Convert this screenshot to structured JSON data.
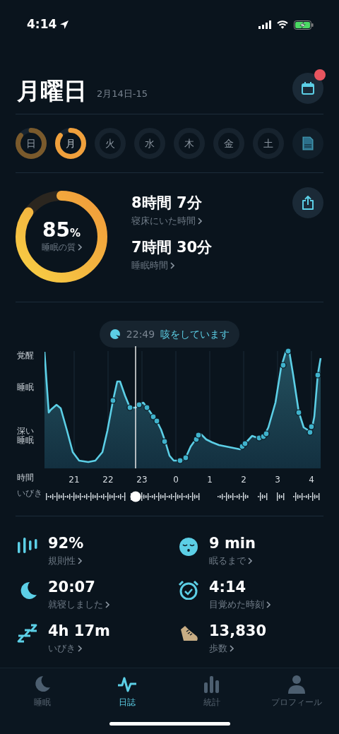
{
  "status_bar": {
    "time": "4:14"
  },
  "header": {
    "title": "月曜日",
    "date": "2月14日-15",
    "calendar_badge": true
  },
  "days": [
    {
      "label": "日",
      "selected": false,
      "level": 0.85
    },
    {
      "label": "月",
      "selected": true,
      "level": 0.85
    },
    {
      "label": "火",
      "selected": false
    },
    {
      "label": "水",
      "selected": false
    },
    {
      "label": "木",
      "selected": false
    },
    {
      "label": "金",
      "selected": false
    },
    {
      "label": "土",
      "selected": false
    }
  ],
  "summary": {
    "level": 0.85,
    "quality_value": "85",
    "quality_unit": "%",
    "quality_label": "睡眠の質",
    "stats": [
      {
        "value": "8時間 7分",
        "label": "寝床にいた時間"
      },
      {
        "value": "7時間 30分",
        "label": "睡眠時間"
      }
    ]
  },
  "event": {
    "time": "22:49",
    "text": "咳をしています"
  },
  "graph": {
    "y_labels": [
      "覚醒",
      "睡眠",
      "深い睡眠"
    ],
    "x_title": "時間",
    "hours": [
      "21",
      "22",
      "23",
      "0",
      "1",
      "2",
      "3",
      "4"
    ],
    "snore_label": "いびき"
  },
  "metrics": [
    {
      "kind": "regularity",
      "value": "92%",
      "label": "規則性"
    },
    {
      "kind": "latency",
      "value": "9 min",
      "label": "眠るまで"
    },
    {
      "kind": "bedtime",
      "value": "20:07",
      "label": "就寝しました"
    },
    {
      "kind": "wakeup",
      "value": "4:14",
      "label": "目覚めた時刻"
    },
    {
      "kind": "snore",
      "value": "4h 17m",
      "label": "いびき"
    },
    {
      "kind": "steps",
      "value": "13,830",
      "label": "歩数"
    }
  ],
  "tabs": [
    {
      "kind": "sleep",
      "label": "睡眠",
      "selected": false
    },
    {
      "kind": "journal",
      "label": "日誌",
      "selected": true
    },
    {
      "kind": "stats",
      "label": "統計",
      "selected": false
    },
    {
      "kind": "profile",
      "label": "プロフィール",
      "selected": false
    }
  ]
}
